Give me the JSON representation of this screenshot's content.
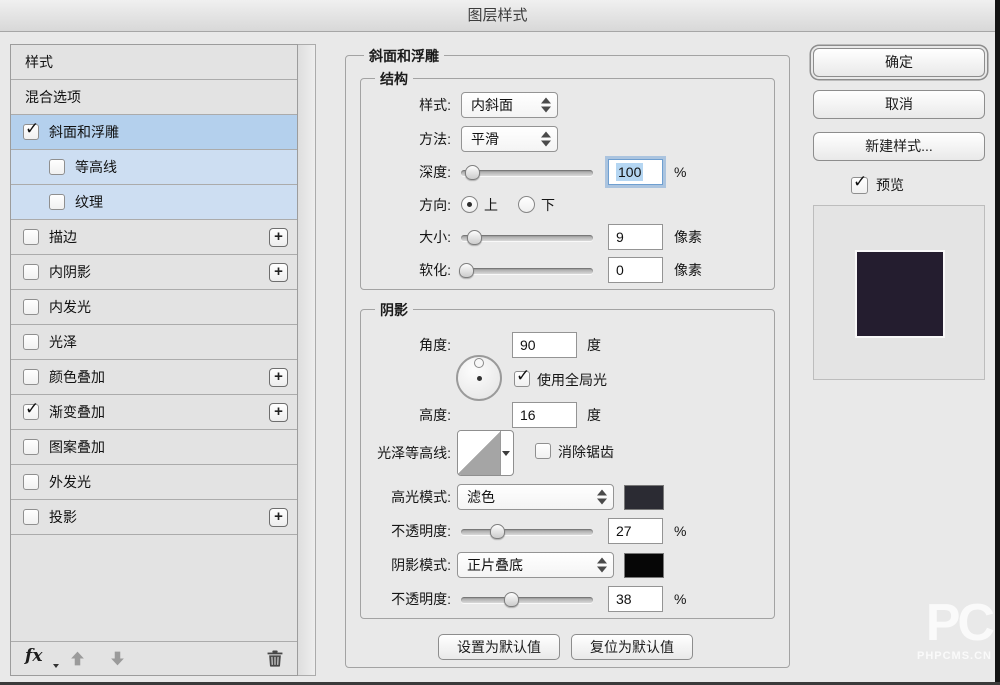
{
  "dialog": {
    "title": "图层样式"
  },
  "sidebar": {
    "items": [
      {
        "label": "样式",
        "checkbox": false,
        "checked": false,
        "plus": false,
        "selected": false,
        "sub": false
      },
      {
        "label": "混合选项",
        "checkbox": false,
        "checked": false,
        "plus": false,
        "selected": false,
        "sub": false
      },
      {
        "label": "斜面和浮雕",
        "checkbox": true,
        "checked": true,
        "plus": false,
        "selected": true,
        "sub": false
      },
      {
        "label": "等高线",
        "checkbox": true,
        "checked": false,
        "plus": false,
        "selected": false,
        "sub": true
      },
      {
        "label": "纹理",
        "checkbox": true,
        "checked": false,
        "plus": false,
        "selected": false,
        "sub": true
      },
      {
        "label": "描边",
        "checkbox": true,
        "checked": false,
        "plus": true,
        "selected": false,
        "sub": false
      },
      {
        "label": "内阴影",
        "checkbox": true,
        "checked": false,
        "plus": true,
        "selected": false,
        "sub": false
      },
      {
        "label": "内发光",
        "checkbox": true,
        "checked": false,
        "plus": false,
        "selected": false,
        "sub": false
      },
      {
        "label": "光泽",
        "checkbox": true,
        "checked": false,
        "plus": false,
        "selected": false,
        "sub": false
      },
      {
        "label": "颜色叠加",
        "checkbox": true,
        "checked": false,
        "plus": true,
        "selected": false,
        "sub": false
      },
      {
        "label": "渐变叠加",
        "checkbox": true,
        "checked": true,
        "plus": true,
        "selected": false,
        "sub": false
      },
      {
        "label": "图案叠加",
        "checkbox": true,
        "checked": false,
        "plus": false,
        "selected": false,
        "sub": false
      },
      {
        "label": "外发光",
        "checkbox": true,
        "checked": false,
        "plus": false,
        "selected": false,
        "sub": false
      },
      {
        "label": "投影",
        "checkbox": true,
        "checked": false,
        "plus": true,
        "selected": false,
        "sub": false
      }
    ],
    "footer": {
      "fx_label": "fx"
    }
  },
  "main": {
    "title": "斜面和浮雕",
    "structure": {
      "legend": "结构",
      "style": {
        "label": "样式:",
        "value": "内斜面"
      },
      "technique": {
        "label": "方法:",
        "value": "平滑"
      },
      "depth": {
        "label": "深度:",
        "value": "100",
        "unit": "%",
        "slider_pct": 8,
        "focused": true
      },
      "direction": {
        "label": "方向:",
        "up_label": "上",
        "down_label": "下",
        "selected": "上"
      },
      "size": {
        "label": "大小:",
        "value": "9",
        "unit": "像素",
        "slider_pct": 10
      },
      "soften": {
        "label": "软化:",
        "value": "0",
        "unit": "像素",
        "slider_pct": 4
      }
    },
    "shading": {
      "legend": "阴影",
      "angle": {
        "label": "角度:",
        "value": "90",
        "unit": "度"
      },
      "global_light_label": "使用全局光",
      "global_light_checked": true,
      "altitude": {
        "label": "高度:",
        "value": "16",
        "unit": "度"
      },
      "gloss_contour": {
        "label": "光泽等高线:",
        "anti_alias_label": "消除锯齿",
        "anti_alias_checked": false
      },
      "highlight_mode": {
        "label": "高光模式:",
        "value": "滤色",
        "swatch": "#2b2b33"
      },
      "highlight_opacity": {
        "label": "不透明度:",
        "value": "27",
        "unit": "%",
        "slider_pct": 27
      },
      "shadow_mode": {
        "label": "阴影模式:",
        "value": "正片叠底",
        "swatch": "#060606"
      },
      "shadow_opacity": {
        "label": "不透明度:",
        "value": "38",
        "unit": "%",
        "slider_pct": 38
      }
    },
    "footer_buttons": {
      "set_default": "设置为默认值",
      "reset_default": "复位为默认值"
    }
  },
  "actions": {
    "ok": "确定",
    "cancel": "取消",
    "new_style": "新建样式...",
    "preview_label": "预览",
    "preview_checked": true
  },
  "preview": {
    "swatch_color": "#241d2f"
  },
  "watermark": {
    "line1": "PC",
    "line2": "PHPCMS.CN"
  },
  "colors": {
    "selected_row": "#b4d0ed",
    "sub_row": "#cddef2",
    "dialog_bg": "#e9e9e9"
  }
}
